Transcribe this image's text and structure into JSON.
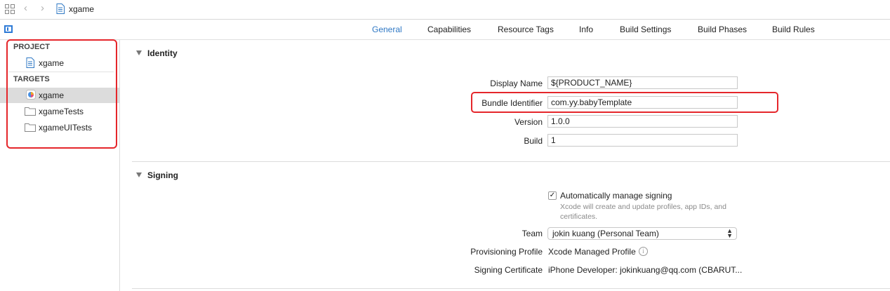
{
  "jumpbar": {
    "breadcrumb": "xgame",
    "back_glyph": "‹",
    "forward_glyph": "›"
  },
  "tabs": [
    {
      "label": "General",
      "active": true
    },
    {
      "label": "Capabilities"
    },
    {
      "label": "Resource Tags"
    },
    {
      "label": "Info"
    },
    {
      "label": "Build Settings"
    },
    {
      "label": "Build Phases"
    },
    {
      "label": "Build Rules"
    }
  ],
  "sidebar": {
    "project_header": "PROJECT",
    "project_item": "xgame",
    "targets_header": "TARGETS",
    "targets": [
      {
        "label": "xgame",
        "icon": "app-target-icon",
        "selected": true
      },
      {
        "label": "xgameTests",
        "icon": "folder-icon"
      },
      {
        "label": "xgameUITests",
        "icon": "folder-icon"
      }
    ]
  },
  "identity": {
    "title": "Identity",
    "display_name_label": "Display Name",
    "display_name_value": "${PRODUCT_NAME}",
    "bundle_id_label": "Bundle Identifier",
    "bundle_id_value": "com.yy.babyTemplate",
    "version_label": "Version",
    "version_value": "1.0.0",
    "build_label": "Build",
    "build_value": "1"
  },
  "signing": {
    "title": "Signing",
    "auto_label": "Automatically manage signing",
    "auto_checked": true,
    "check_glyph": "✓",
    "auto_hint": "Xcode will create and update profiles, app IDs, and certificates.",
    "team_label": "Team",
    "team_value": "jokin kuang (Personal Team)",
    "chevron_glyph": "⌃\n⌄",
    "profile_label": "Provisioning Profile",
    "profile_value": "Xcode Managed Profile",
    "info_glyph": "i",
    "cert_label": "Signing Certificate",
    "cert_value": "iPhone Developer: jokinkuang@qq.com (CBARUT..."
  },
  "colors": {
    "accent": "#2f78c4",
    "highlight": "#e5262b",
    "selection": "#dcdcdc"
  }
}
